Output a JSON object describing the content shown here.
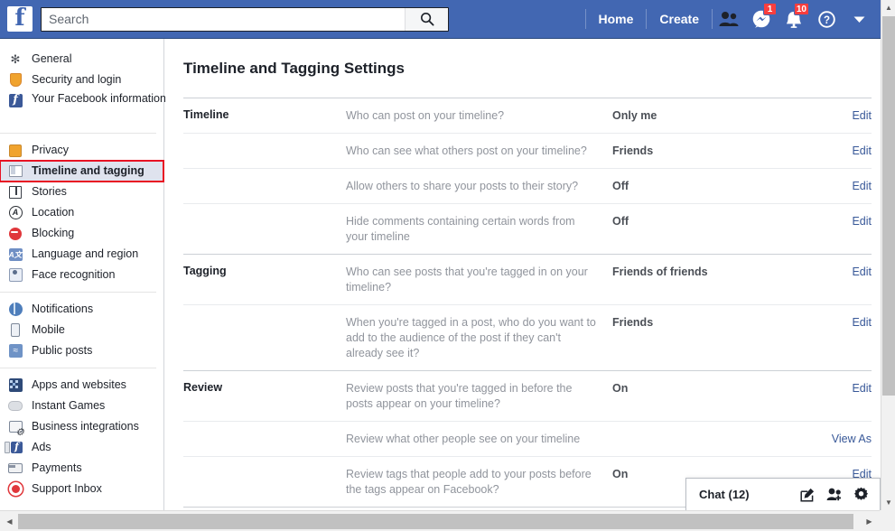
{
  "topnav": {
    "logo": "f",
    "search": {
      "placeholder": "Search",
      "value": "",
      "icon": "search-icon"
    },
    "links": [
      {
        "label": "Home",
        "name": "nav-home"
      },
      {
        "label": "Create",
        "name": "nav-create"
      }
    ],
    "icons": [
      {
        "name": "friend-requests-icon",
        "badge": ""
      },
      {
        "name": "messenger-icon",
        "badge": "1"
      },
      {
        "name": "notifications-icon",
        "badge": "10"
      },
      {
        "name": "help-icon",
        "badge": ""
      },
      {
        "name": "account-dropdown-icon",
        "badge": ""
      }
    ]
  },
  "sidebar": {
    "groups": [
      {
        "items": [
          {
            "label": "General",
            "icon": "general-icon",
            "active": false
          },
          {
            "label": "Security and login",
            "icon": "shield-icon",
            "active": false
          },
          {
            "label": "Your Facebook information",
            "icon": "facebook-icon",
            "active": false,
            "twoline": true
          }
        ]
      },
      {
        "items": [
          {
            "label": "Privacy",
            "icon": "lock-icon",
            "active": false
          },
          {
            "label": "Timeline and tagging",
            "icon": "timeline-icon",
            "active": true
          },
          {
            "label": "Stories",
            "icon": "book-icon",
            "active": false
          },
          {
            "label": "Location",
            "icon": "location-icon",
            "active": false
          },
          {
            "label": "Blocking",
            "icon": "block-icon",
            "active": false
          },
          {
            "label": "Language and region",
            "icon": "language-icon",
            "active": false
          },
          {
            "label": "Face recognition",
            "icon": "face-icon",
            "active": false
          }
        ]
      },
      {
        "items": [
          {
            "label": "Notifications",
            "icon": "globe-icon",
            "active": false
          },
          {
            "label": "Mobile",
            "icon": "mobile-icon",
            "active": false
          },
          {
            "label": "Public posts",
            "icon": "rss-icon",
            "active": false
          }
        ]
      },
      {
        "items": [
          {
            "label": "Apps and websites",
            "icon": "apps-icon",
            "active": false
          },
          {
            "label": "Instant Games",
            "icon": "gamepad-icon",
            "active": false
          },
          {
            "label": "Business integrations",
            "icon": "business-icon",
            "active": false
          },
          {
            "label": "Ads",
            "icon": "ads-icon",
            "active": false
          },
          {
            "label": "Payments",
            "icon": "payments-icon",
            "active": false
          },
          {
            "label": "Support Inbox",
            "icon": "support-icon",
            "active": false
          }
        ]
      }
    ]
  },
  "main": {
    "title": "Timeline and Tagging Settings",
    "sections": [
      {
        "label": "Timeline",
        "rows": [
          {
            "question": "Who can post on your timeline?",
            "value": "Only me",
            "action": "Edit"
          },
          {
            "question": "Who can see what others post on your timeline?",
            "value": "Friends",
            "action": "Edit"
          },
          {
            "question": "Allow others to share your posts to their story?",
            "value": "Off",
            "action": "Edit"
          },
          {
            "question": "Hide comments containing certain words from your timeline",
            "value": "Off",
            "action": "Edit"
          }
        ]
      },
      {
        "label": "Tagging",
        "rows": [
          {
            "question": "Who can see posts that you're tagged in on your timeline?",
            "value": "Friends of friends",
            "action": "Edit"
          },
          {
            "question": "When you're tagged in a post, who do you want to add to the audience of the post if they can't already see it?",
            "value": "Friends",
            "action": "Edit"
          }
        ]
      },
      {
        "label": "Review",
        "rows": [
          {
            "question": "Review posts that you're tagged in before the posts appear on your timeline?",
            "value": "On",
            "action": "Edit"
          },
          {
            "question": "Review what other people see on your timeline",
            "value": "",
            "action": "View As"
          },
          {
            "question": "Review tags that people add to your posts before the tags appear on Facebook?",
            "value": "On",
            "action": "Edit"
          }
        ]
      }
    ]
  },
  "chatbar": {
    "label": "Chat (12)",
    "icons": [
      {
        "name": "new-message-icon"
      },
      {
        "name": "friend-list-icon"
      },
      {
        "name": "chat-settings-icon"
      }
    ]
  },
  "colors": {
    "brand_blue": "#4267b2",
    "link_blue": "#385898",
    "badge_red": "#fa3e3e",
    "highlight_red": "#e81123",
    "active_bg": "#dfe3ee"
  }
}
